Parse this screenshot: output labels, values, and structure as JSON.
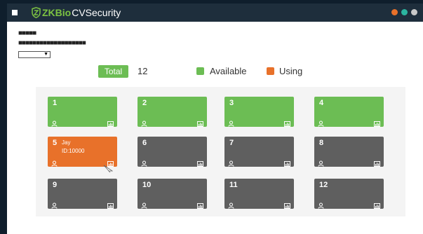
{
  "app": {
    "brand": "ZKBio",
    "product": "CVSecurity",
    "window_dots": [
      "#e8712a",
      "#2bb5a0",
      "#c9c9c9"
    ]
  },
  "header": {
    "line1": "■■■■■",
    "line2": "■■■■■■■■■■■■■■■■■■■"
  },
  "select": {
    "value": "",
    "caret": "▼"
  },
  "summary": {
    "total_label": "Total",
    "total_count": "12",
    "legend": [
      {
        "label": "Available",
        "color": "#6cbd54"
      },
      {
        "label": "Using",
        "color": "#e8712a"
      }
    ]
  },
  "status_colors": {
    "available": "#6cbd54",
    "using": "#e8712a",
    "offline": "#5f5f5f"
  },
  "tiles": [
    {
      "number": "1",
      "status": "available",
      "user_name": "",
      "user_id": ""
    },
    {
      "number": "2",
      "status": "available",
      "user_name": "",
      "user_id": ""
    },
    {
      "number": "3",
      "status": "available",
      "user_name": "",
      "user_id": ""
    },
    {
      "number": "4",
      "status": "available",
      "user_name": "",
      "user_id": ""
    },
    {
      "number": "5",
      "status": "using",
      "user_name": "Jay",
      "user_id": "ID:10000"
    },
    {
      "number": "6",
      "status": "offline",
      "user_name": "",
      "user_id": ""
    },
    {
      "number": "7",
      "status": "offline",
      "user_name": "",
      "user_id": ""
    },
    {
      "number": "8",
      "status": "offline",
      "user_name": "",
      "user_id": ""
    },
    {
      "number": "9",
      "status": "offline",
      "user_name": "",
      "user_id": ""
    },
    {
      "number": "10",
      "status": "offline",
      "user_name": "",
      "user_id": ""
    },
    {
      "number": "11",
      "status": "offline",
      "user_name": "",
      "user_id": ""
    },
    {
      "number": "12",
      "status": "offline",
      "user_name": "",
      "user_id": ""
    }
  ]
}
